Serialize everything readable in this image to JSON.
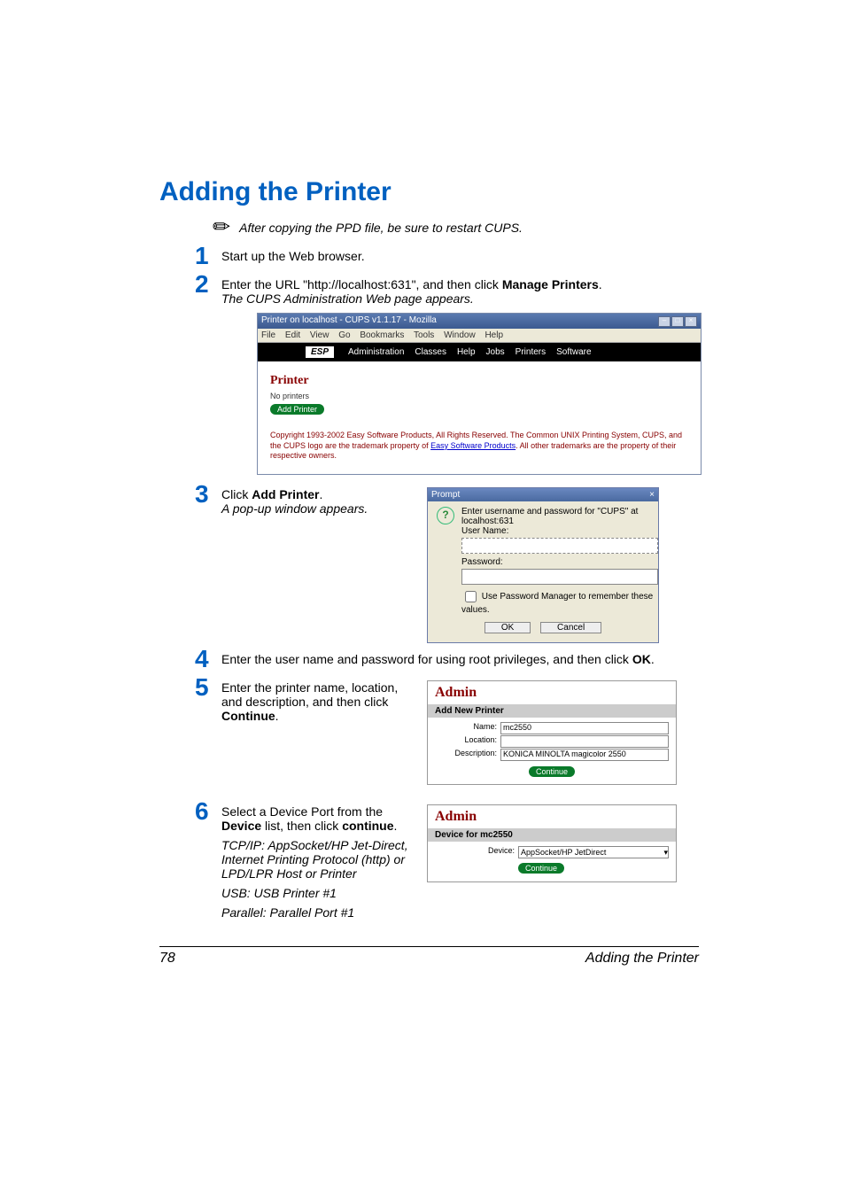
{
  "title": "Adding the Printer",
  "note": {
    "icon": "✏",
    "text": "After copying the PPD file, be sure to restart CUPS."
  },
  "steps": {
    "s1": {
      "num": "1",
      "text": "Start up the Web browser."
    },
    "s2": {
      "num": "2",
      "pre": "Enter the URL \"http://localhost:631\", and then click ",
      "bold": "Manage Printers",
      "post": ".",
      "sub": "The CUPS Administration Web page appears."
    },
    "s3": {
      "num": "3",
      "pre": "Click ",
      "bold": "Add Printer",
      "post": ".",
      "sub": "A pop-up window appears."
    },
    "s4": {
      "num": "4",
      "pre": "Enter the user name and password for using root privileges, and then click ",
      "bold": "OK",
      "post": "."
    },
    "s5": {
      "num": "5",
      "pre": "Enter the printer name, location, and description, and then click ",
      "bold": "Continue",
      "post": "."
    },
    "s6": {
      "num": "6",
      "pre1": "Select a Device Port from the ",
      "bold1": "Device",
      "mid": " list, then click ",
      "bold2": "continue",
      "post": ".",
      "sub1": "TCP/IP: AppSocket/HP Jet-Direct, Internet Printing Protocol (http) or LPD/LPR Host or Printer",
      "sub2": "USB: USB Printer #1",
      "sub3": "Parallel: Parallel Port #1"
    }
  },
  "browser": {
    "title": "Printer on localhost - CUPS v1.1.17 - Mozilla",
    "menu": {
      "file": "File",
      "edit": "Edit",
      "view": "View",
      "go": "Go",
      "bookmarks": "Bookmarks",
      "tools": "Tools",
      "window": "Window",
      "help": "Help"
    },
    "nav": {
      "esp": "ESP",
      "administration": "Administration",
      "classes": "Classes",
      "help": "Help",
      "jobs": "Jobs",
      "printers": "Printers",
      "software": "Software"
    },
    "heading": "Printer",
    "noprinters": "No printers",
    "addprinter_btn": "Add Printer",
    "footer_pre": "Copyright 1993-2002 Easy Software Products, All Rights Reserved. The Common UNIX Printing System, CUPS, and the CUPS logo are the trademark property of ",
    "footer_link": "Easy Software Products",
    "footer_post": ". All other trademarks are the property of their respective owners."
  },
  "prompt": {
    "title": "Prompt",
    "msg": "Enter username and password for \"CUPS\" at localhost:631",
    "username_label": "User Name:",
    "password_label": "Password:",
    "remember": "Use Password Manager to remember these values.",
    "ok": "OK",
    "cancel": "Cancel"
  },
  "admin1": {
    "heading": "Admin",
    "sub": "Add New Printer",
    "name_label": "Name:",
    "name_val": "mc2550",
    "loc_label": "Location:",
    "loc_val": "",
    "desc_label": "Description:",
    "desc_val": "KONICA MINOLTA magicolor 2550",
    "button": "Continue"
  },
  "admin2": {
    "heading": "Admin",
    "sub": "Device for mc2550",
    "device_label": "Device:",
    "device_val": "AppSocket/HP JetDirect",
    "button": "Continue"
  },
  "footer": {
    "page": "78",
    "section": "Adding the Printer"
  }
}
